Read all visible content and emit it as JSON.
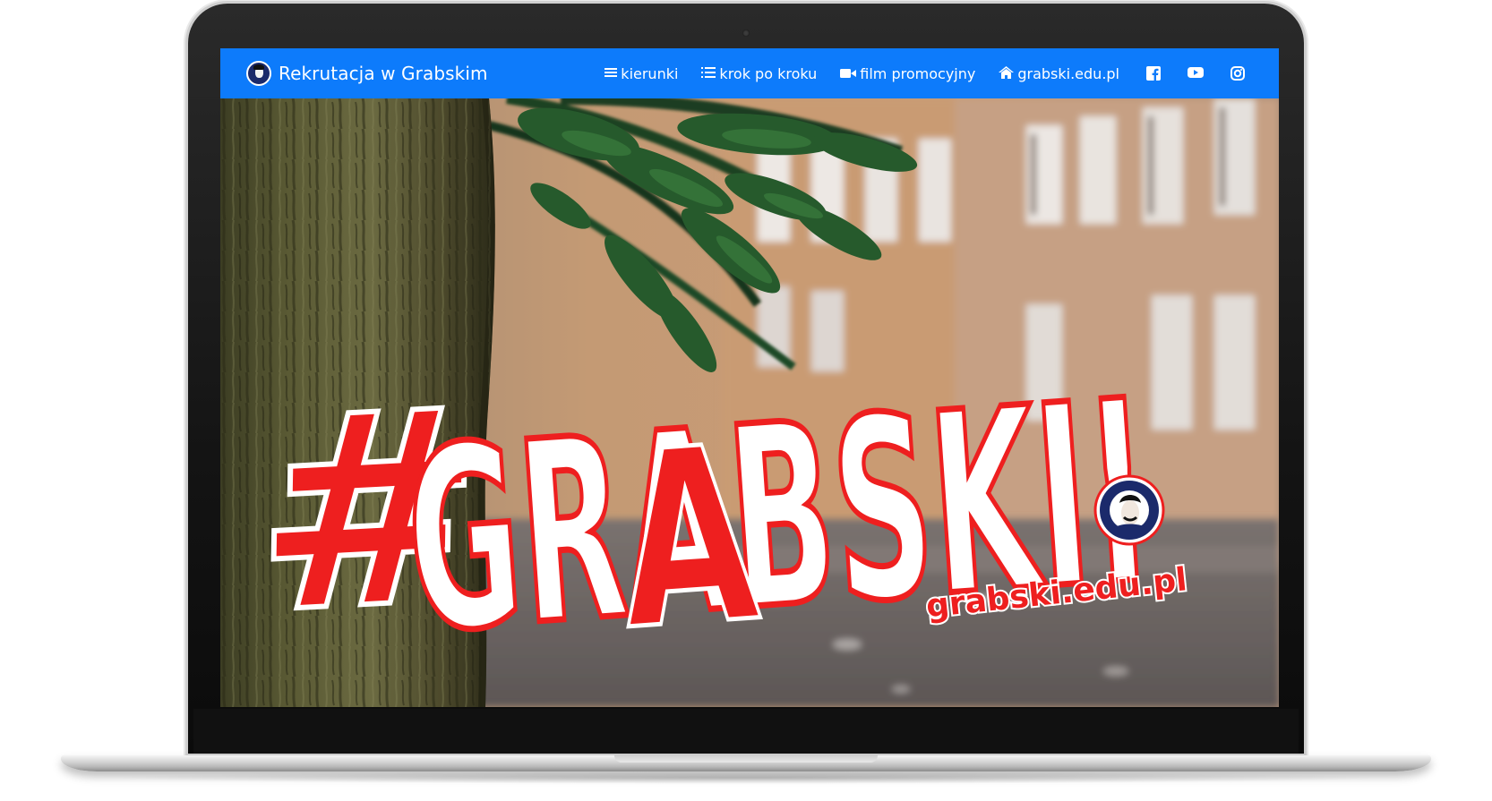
{
  "navbar": {
    "brand_text": "Rekrutacja w Grabskim",
    "links": [
      {
        "label": "kierunki",
        "icon": "bars-icon"
      },
      {
        "label": "krok po kroku",
        "icon": "list-ol-icon"
      },
      {
        "label": "film promocyjny",
        "icon": "video-icon"
      },
      {
        "label": "grabski.edu.pl",
        "icon": "home-icon"
      }
    ],
    "social": [
      "facebook-icon",
      "youtube-icon",
      "instagram-icon"
    ],
    "color": "#0d7bfb"
  },
  "hero": {
    "headline_hash": "#",
    "headline": "GRABSKI!",
    "url_text": "grabski.edu.pl",
    "headline_red": "#ee1f1f",
    "headline_white": "#ffffff"
  }
}
